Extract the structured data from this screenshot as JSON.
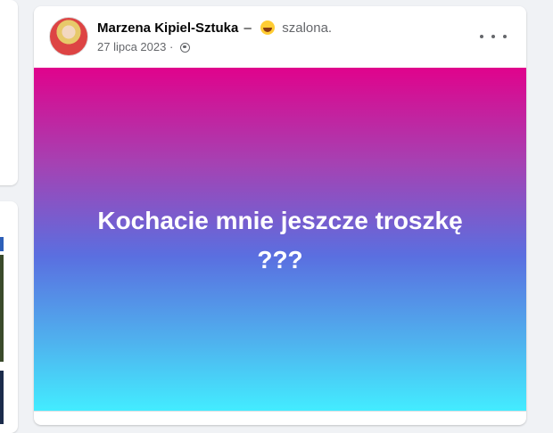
{
  "post": {
    "author": "Marzena Kipiel-Sztuka",
    "separator": "–",
    "feeling_icon": "grinning-face-emoji",
    "feeling": "szalona.",
    "date": "27 lipca 2023",
    "separator_dot": "·",
    "privacy_icon": "globe-icon",
    "text_line1": "Kochacie mnie jeszcze troszkę",
    "text_line2": "???",
    "background_colors": [
      "#e0038c",
      "#5a6fe0",
      "#43ecff"
    ]
  }
}
